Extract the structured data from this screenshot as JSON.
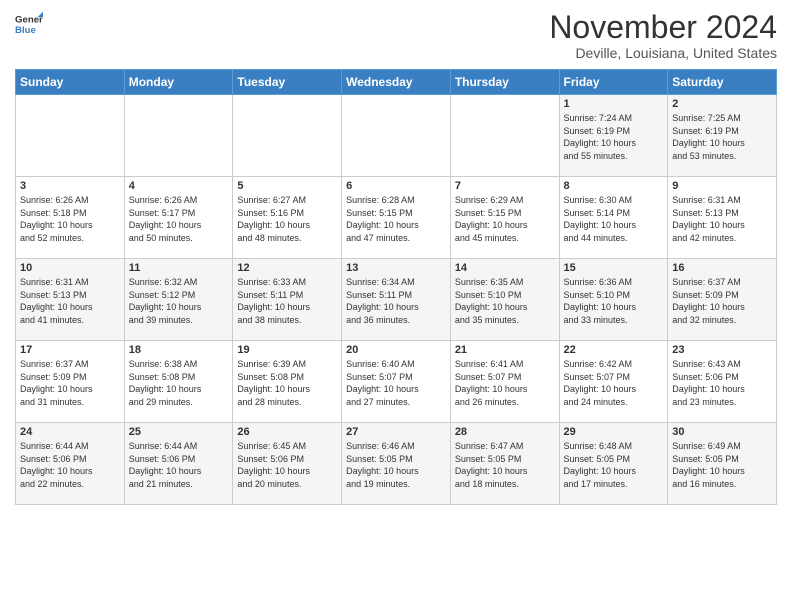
{
  "header": {
    "logo_line1": "General",
    "logo_line2": "Blue",
    "month": "November 2024",
    "location": "Deville, Louisiana, United States"
  },
  "weekdays": [
    "Sunday",
    "Monday",
    "Tuesday",
    "Wednesday",
    "Thursday",
    "Friday",
    "Saturday"
  ],
  "weeks": [
    [
      {
        "day": "",
        "info": ""
      },
      {
        "day": "",
        "info": ""
      },
      {
        "day": "",
        "info": ""
      },
      {
        "day": "",
        "info": ""
      },
      {
        "day": "",
        "info": ""
      },
      {
        "day": "1",
        "info": "Sunrise: 7:24 AM\nSunset: 6:19 PM\nDaylight: 10 hours\nand 55 minutes."
      },
      {
        "day": "2",
        "info": "Sunrise: 7:25 AM\nSunset: 6:19 PM\nDaylight: 10 hours\nand 53 minutes."
      }
    ],
    [
      {
        "day": "3",
        "info": "Sunrise: 6:26 AM\nSunset: 5:18 PM\nDaylight: 10 hours\nand 52 minutes."
      },
      {
        "day": "4",
        "info": "Sunrise: 6:26 AM\nSunset: 5:17 PM\nDaylight: 10 hours\nand 50 minutes."
      },
      {
        "day": "5",
        "info": "Sunrise: 6:27 AM\nSunset: 5:16 PM\nDaylight: 10 hours\nand 48 minutes."
      },
      {
        "day": "6",
        "info": "Sunrise: 6:28 AM\nSunset: 5:15 PM\nDaylight: 10 hours\nand 47 minutes."
      },
      {
        "day": "7",
        "info": "Sunrise: 6:29 AM\nSunset: 5:15 PM\nDaylight: 10 hours\nand 45 minutes."
      },
      {
        "day": "8",
        "info": "Sunrise: 6:30 AM\nSunset: 5:14 PM\nDaylight: 10 hours\nand 44 minutes."
      },
      {
        "day": "9",
        "info": "Sunrise: 6:31 AM\nSunset: 5:13 PM\nDaylight: 10 hours\nand 42 minutes."
      }
    ],
    [
      {
        "day": "10",
        "info": "Sunrise: 6:31 AM\nSunset: 5:13 PM\nDaylight: 10 hours\nand 41 minutes."
      },
      {
        "day": "11",
        "info": "Sunrise: 6:32 AM\nSunset: 5:12 PM\nDaylight: 10 hours\nand 39 minutes."
      },
      {
        "day": "12",
        "info": "Sunrise: 6:33 AM\nSunset: 5:11 PM\nDaylight: 10 hours\nand 38 minutes."
      },
      {
        "day": "13",
        "info": "Sunrise: 6:34 AM\nSunset: 5:11 PM\nDaylight: 10 hours\nand 36 minutes."
      },
      {
        "day": "14",
        "info": "Sunrise: 6:35 AM\nSunset: 5:10 PM\nDaylight: 10 hours\nand 35 minutes."
      },
      {
        "day": "15",
        "info": "Sunrise: 6:36 AM\nSunset: 5:10 PM\nDaylight: 10 hours\nand 33 minutes."
      },
      {
        "day": "16",
        "info": "Sunrise: 6:37 AM\nSunset: 5:09 PM\nDaylight: 10 hours\nand 32 minutes."
      }
    ],
    [
      {
        "day": "17",
        "info": "Sunrise: 6:37 AM\nSunset: 5:09 PM\nDaylight: 10 hours\nand 31 minutes."
      },
      {
        "day": "18",
        "info": "Sunrise: 6:38 AM\nSunset: 5:08 PM\nDaylight: 10 hours\nand 29 minutes."
      },
      {
        "day": "19",
        "info": "Sunrise: 6:39 AM\nSunset: 5:08 PM\nDaylight: 10 hours\nand 28 minutes."
      },
      {
        "day": "20",
        "info": "Sunrise: 6:40 AM\nSunset: 5:07 PM\nDaylight: 10 hours\nand 27 minutes."
      },
      {
        "day": "21",
        "info": "Sunrise: 6:41 AM\nSunset: 5:07 PM\nDaylight: 10 hours\nand 26 minutes."
      },
      {
        "day": "22",
        "info": "Sunrise: 6:42 AM\nSunset: 5:07 PM\nDaylight: 10 hours\nand 24 minutes."
      },
      {
        "day": "23",
        "info": "Sunrise: 6:43 AM\nSunset: 5:06 PM\nDaylight: 10 hours\nand 23 minutes."
      }
    ],
    [
      {
        "day": "24",
        "info": "Sunrise: 6:44 AM\nSunset: 5:06 PM\nDaylight: 10 hours\nand 22 minutes."
      },
      {
        "day": "25",
        "info": "Sunrise: 6:44 AM\nSunset: 5:06 PM\nDaylight: 10 hours\nand 21 minutes."
      },
      {
        "day": "26",
        "info": "Sunrise: 6:45 AM\nSunset: 5:06 PM\nDaylight: 10 hours\nand 20 minutes."
      },
      {
        "day": "27",
        "info": "Sunrise: 6:46 AM\nSunset: 5:05 PM\nDaylight: 10 hours\nand 19 minutes."
      },
      {
        "day": "28",
        "info": "Sunrise: 6:47 AM\nSunset: 5:05 PM\nDaylight: 10 hours\nand 18 minutes."
      },
      {
        "day": "29",
        "info": "Sunrise: 6:48 AM\nSunset: 5:05 PM\nDaylight: 10 hours\nand 17 minutes."
      },
      {
        "day": "30",
        "info": "Sunrise: 6:49 AM\nSunset: 5:05 PM\nDaylight: 10 hours\nand 16 minutes."
      }
    ]
  ]
}
